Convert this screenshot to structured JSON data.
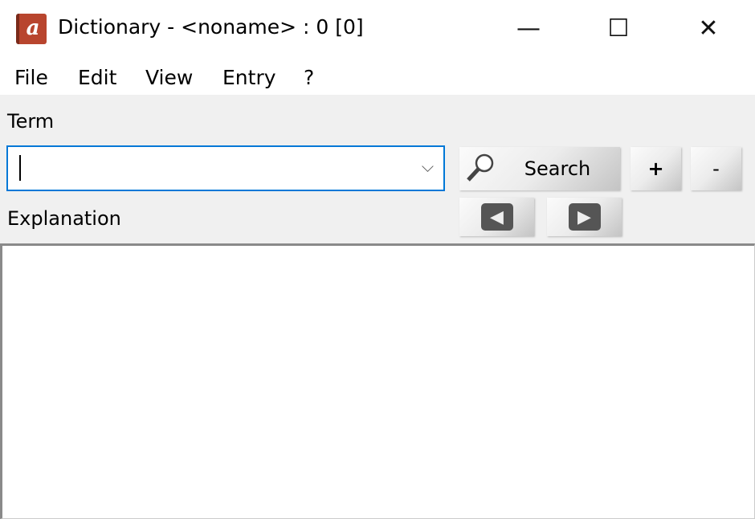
{
  "window": {
    "title": "Dictionary - <noname> : 0 [0]",
    "icon": "a",
    "minimize": "—",
    "maximize": "☐",
    "close": "✕"
  },
  "menu": [
    "File",
    "Edit",
    "View",
    "Entry",
    "?"
  ],
  "term": {
    "label": "Term",
    "value": "",
    "dropdown": "⌵"
  },
  "buttons": {
    "search": "Search",
    "add": "+",
    "remove": "-",
    "prev": "◀",
    "next": "▶"
  },
  "explanation": {
    "label": "Explanation",
    "text": ""
  },
  "colors": {
    "focus": "#0078d7",
    "panel": "#f0f0f0",
    "icon": "#b8452e"
  }
}
